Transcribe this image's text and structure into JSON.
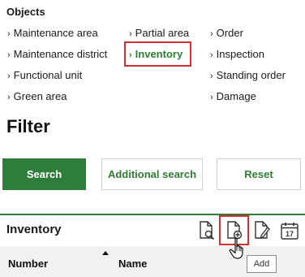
{
  "objects": {
    "title": "Objects",
    "column1": [
      "Maintenance area",
      "Maintenance district",
      "Functional unit",
      "Green area"
    ],
    "column2": [
      "Partial area",
      "Inventory"
    ],
    "column3": [
      "Order",
      "Inspection",
      "Standing order",
      "Damage"
    ],
    "active_item": "Inventory"
  },
  "filter": {
    "title": "Filter",
    "search_label": "Search",
    "additional_search_label": "Additional search",
    "reset_label": "Reset"
  },
  "inventory": {
    "title": "Inventory",
    "tooltip": "Add",
    "icons": [
      "search-document-icon",
      "add-document-icon",
      "edit-document-icon",
      "calendar-icon"
    ],
    "calendar_day": "17",
    "columns": [
      "Number",
      "Name"
    ],
    "sort_column": "Number"
  },
  "colors": {
    "accent": "#2e7d32",
    "highlight": "#d32f2f"
  }
}
